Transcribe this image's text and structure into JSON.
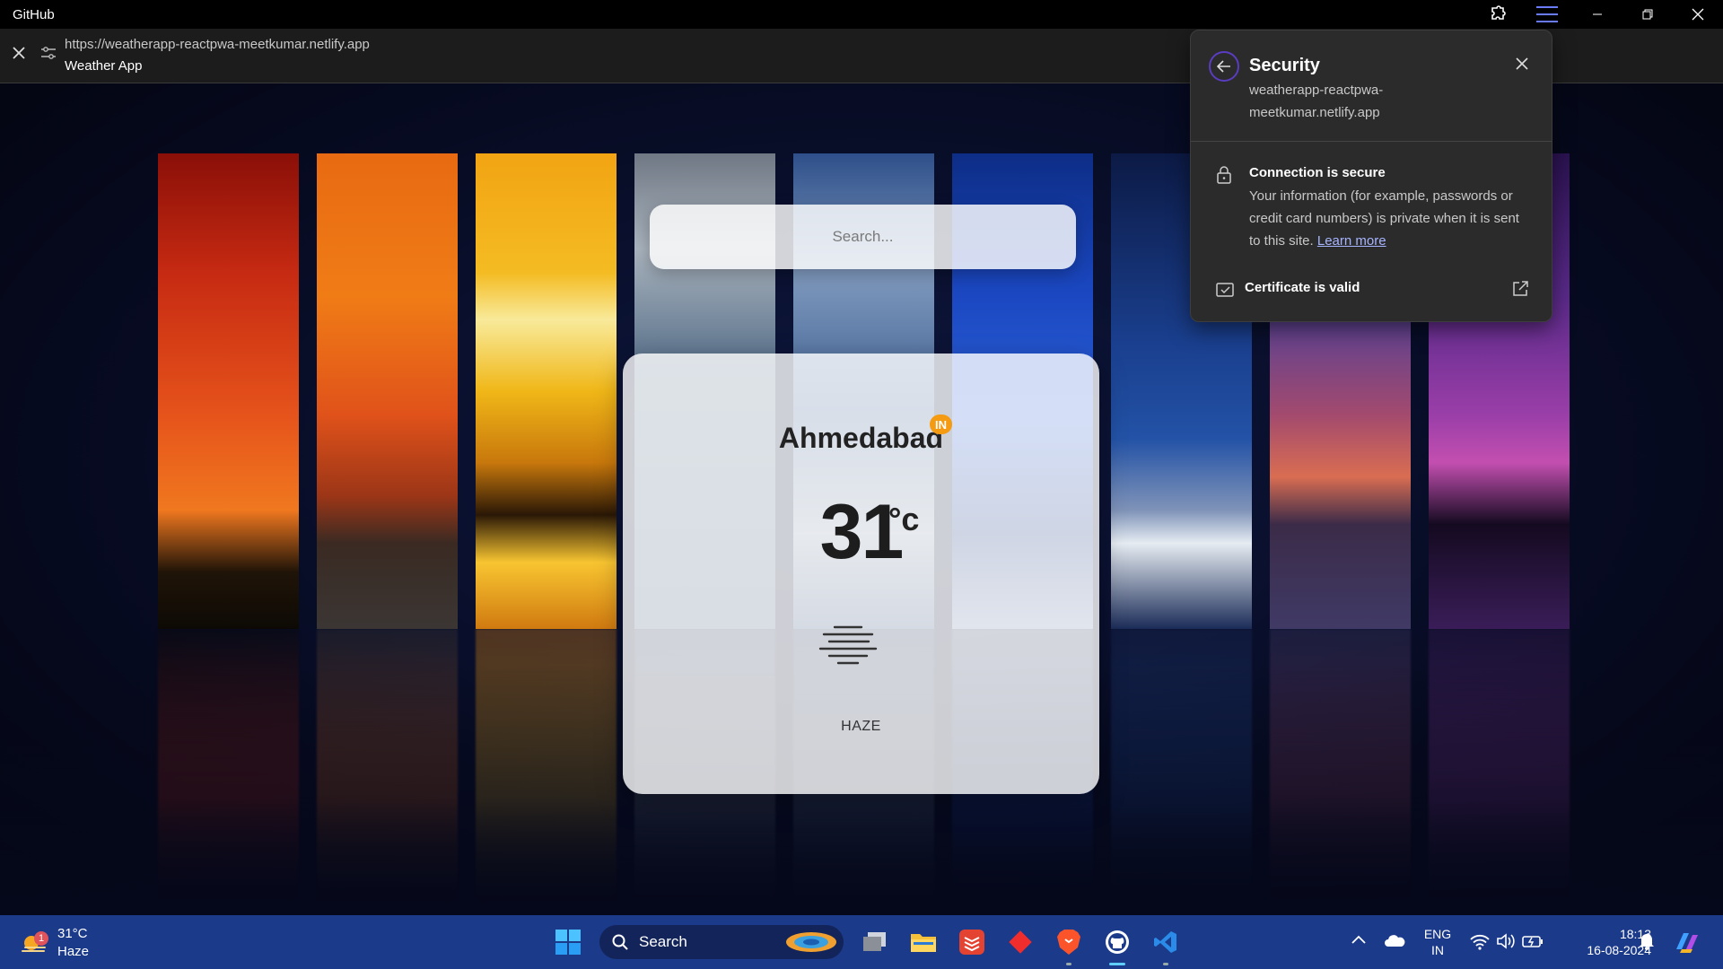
{
  "window": {
    "app_name": "GitHub"
  },
  "address_bar": {
    "url": "https://weatherapp-reactpwa-meetkumar.netlify.app",
    "page_title": "Weather App"
  },
  "weather_app": {
    "search_placeholder": "Search...",
    "city": "Ahmedabad",
    "country_code": "IN",
    "temperature": "31",
    "temperature_unit": "°c",
    "condition": "HAZE",
    "condition_icon": "haze-icon"
  },
  "security_popup": {
    "title": "Security",
    "host": "weatherapp-reactpwa-meetkumar.netlify.app",
    "connection_title": "Connection is secure",
    "connection_description": "Your information (for example, passwords or credit card numbers) is private when it is sent to this site.",
    "learn_more": "Learn more",
    "certificate_label": "Certificate is valid",
    "accent_color": "#5a3cc0"
  },
  "taskbar": {
    "weather_temp": "31°C",
    "weather_condition": "Haze",
    "weather_badge": "1",
    "search_label": "Search",
    "apps": [
      "start-icon",
      "search",
      "task-view-icon",
      "file-explorer-icon",
      "todoist-icon",
      "git-icon",
      "brave-icon",
      "github-desktop-icon",
      "vscode-icon"
    ],
    "language": "ENG",
    "region": "IN",
    "time": "18:13",
    "date": "16-08-2024",
    "color": "#1b3a8a"
  }
}
